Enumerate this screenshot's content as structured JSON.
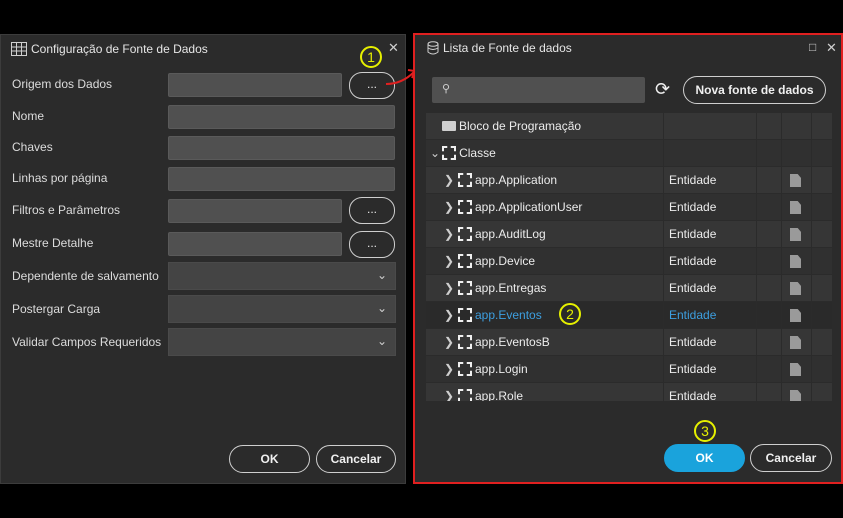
{
  "left_dialog": {
    "title": "Configuração de Fonte de Dados",
    "close_label": "✕",
    "fields": [
      {
        "label": "Origem dos Dados",
        "button": "..."
      },
      {
        "label": "Nome"
      },
      {
        "label": "Chaves"
      },
      {
        "label": "Linhas por página"
      },
      {
        "label": "Filtros e Parâmetros",
        "button": "..."
      },
      {
        "label": "Mestre Detalhe",
        "button": "..."
      },
      {
        "label": "Dependente de salvamento"
      },
      {
        "label": "Postergar Carga"
      },
      {
        "label": "Validar Campos Requeridos"
      }
    ],
    "ok_label": "OK",
    "cancel_label": "Cancelar"
  },
  "right_dialog": {
    "title": "Lista de Fonte de dados",
    "maximize_label": "□",
    "close_label": "✕",
    "search_placeholder": "",
    "new_button": "Nova fonte de dados",
    "tree": {
      "group_block": "Bloco de Programação",
      "group_class": "Classe",
      "items": [
        {
          "name": "app.Application",
          "type": "Entidade"
        },
        {
          "name": "app.ApplicationUser",
          "type": "Entidade"
        },
        {
          "name": "app.AuditLog",
          "type": "Entidade"
        },
        {
          "name": "app.Device",
          "type": "Entidade"
        },
        {
          "name": "app.Entregas",
          "type": "Entidade"
        },
        {
          "name": "app.Eventos",
          "type": "Entidade",
          "selected": true
        },
        {
          "name": "app.EventosB",
          "type": "Entidade"
        },
        {
          "name": "app.Login",
          "type": "Entidade"
        },
        {
          "name": "app.Role",
          "type": "Entidade"
        }
      ]
    },
    "ok_label": "OK",
    "cancel_label": "Cancelar"
  },
  "annotations": {
    "step1": "1",
    "step2": "2",
    "step3": "3"
  },
  "colors": {
    "accent": "#1aa3dc",
    "highlight": "#e02020",
    "annotation": "#e6f000",
    "selected_text": "#3d9fe0"
  }
}
